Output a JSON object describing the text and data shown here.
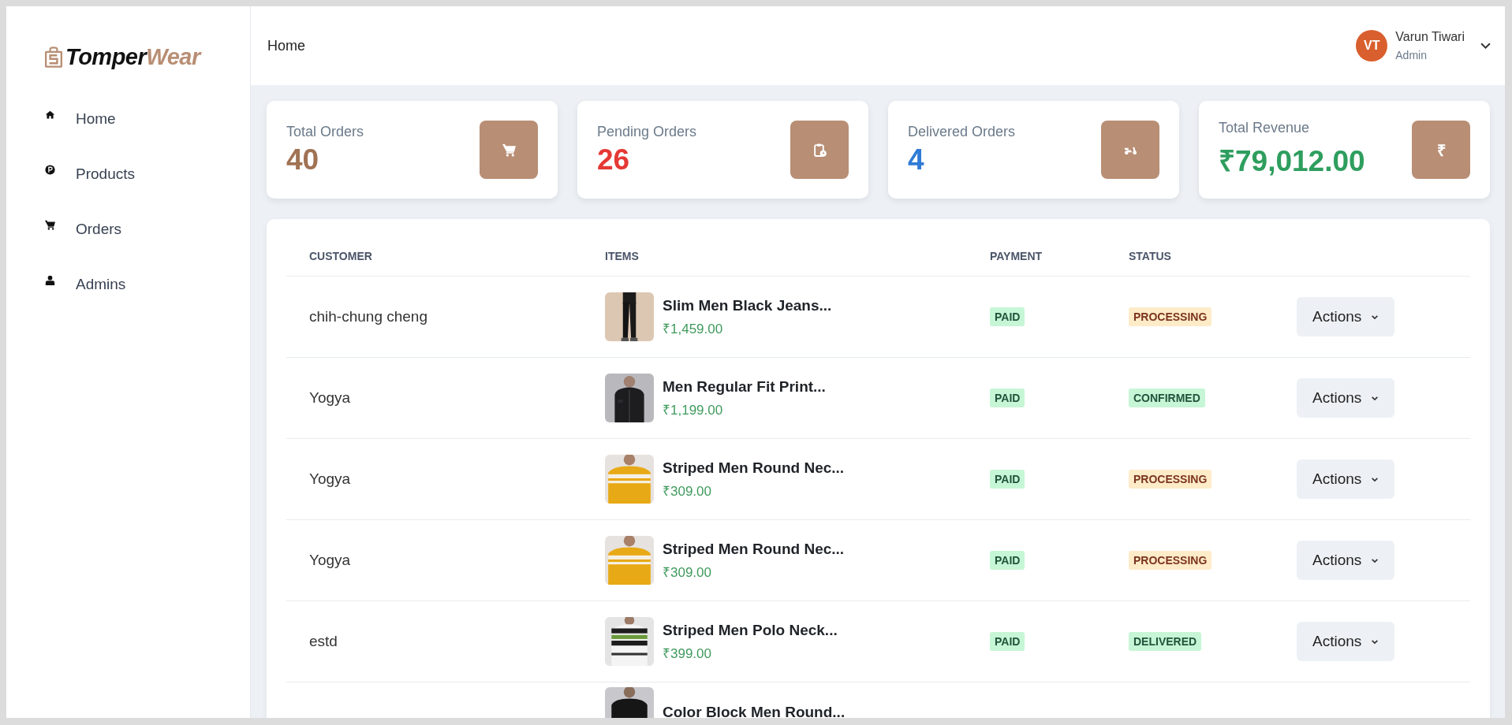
{
  "brand": {
    "first": "Tomper",
    "second": "Wear"
  },
  "sidebar": {
    "items": [
      {
        "label": "Home"
      },
      {
        "label": "Products"
      },
      {
        "label": "Orders"
      },
      {
        "label": "Admins"
      }
    ]
  },
  "header": {
    "title": "Home",
    "user": {
      "initials": "VT",
      "name": "Varun Tiwari",
      "role": "Admin"
    }
  },
  "stats": [
    {
      "label": "Total Orders",
      "value": "40",
      "color": "#a07354"
    },
    {
      "label": "Pending Orders",
      "value": "26",
      "color": "#e53935"
    },
    {
      "label": "Delivered Orders",
      "value": "4",
      "color": "#2f7bd6"
    },
    {
      "label": "Total Revenue",
      "value": "₹79,012.00",
      "color": "#2e9e5e",
      "glyph": "₹"
    }
  ],
  "table": {
    "columns": [
      "CUSTOMER",
      "ITEMS",
      "PAYMENT",
      "STATUS"
    ],
    "rows": [
      {
        "customer": "chih-chung cheng",
        "item": "Slim Men Black Jeans...",
        "price": "₹1,459.00",
        "payment": "PAID",
        "status": {
          "text": "PROCESSING",
          "kind": "warning"
        },
        "action": "Actions"
      },
      {
        "customer": "Yogya",
        "item": "Men Regular Fit Print...",
        "price": "₹1,199.00",
        "payment": "PAID",
        "status": {
          "text": "CONFIRMED",
          "kind": "success"
        },
        "action": "Actions"
      },
      {
        "customer": "Yogya",
        "item": "Striped Men Round Nec...",
        "price": "₹309.00",
        "payment": "PAID",
        "status": {
          "text": "PROCESSING",
          "kind": "warning"
        },
        "action": "Actions"
      },
      {
        "customer": "Yogya",
        "item": "Striped Men Round Nec...",
        "price": "₹309.00",
        "payment": "PAID",
        "status": {
          "text": "PROCESSING",
          "kind": "warning"
        },
        "action": "Actions"
      },
      {
        "customer": "estd",
        "item": "Striped Men Polo Neck...",
        "price": "₹399.00",
        "payment": "PAID",
        "status": {
          "text": "DELIVERED",
          "kind": "success"
        },
        "action": "Actions"
      },
      {
        "item": "Color Block Men Round..."
      }
    ]
  }
}
